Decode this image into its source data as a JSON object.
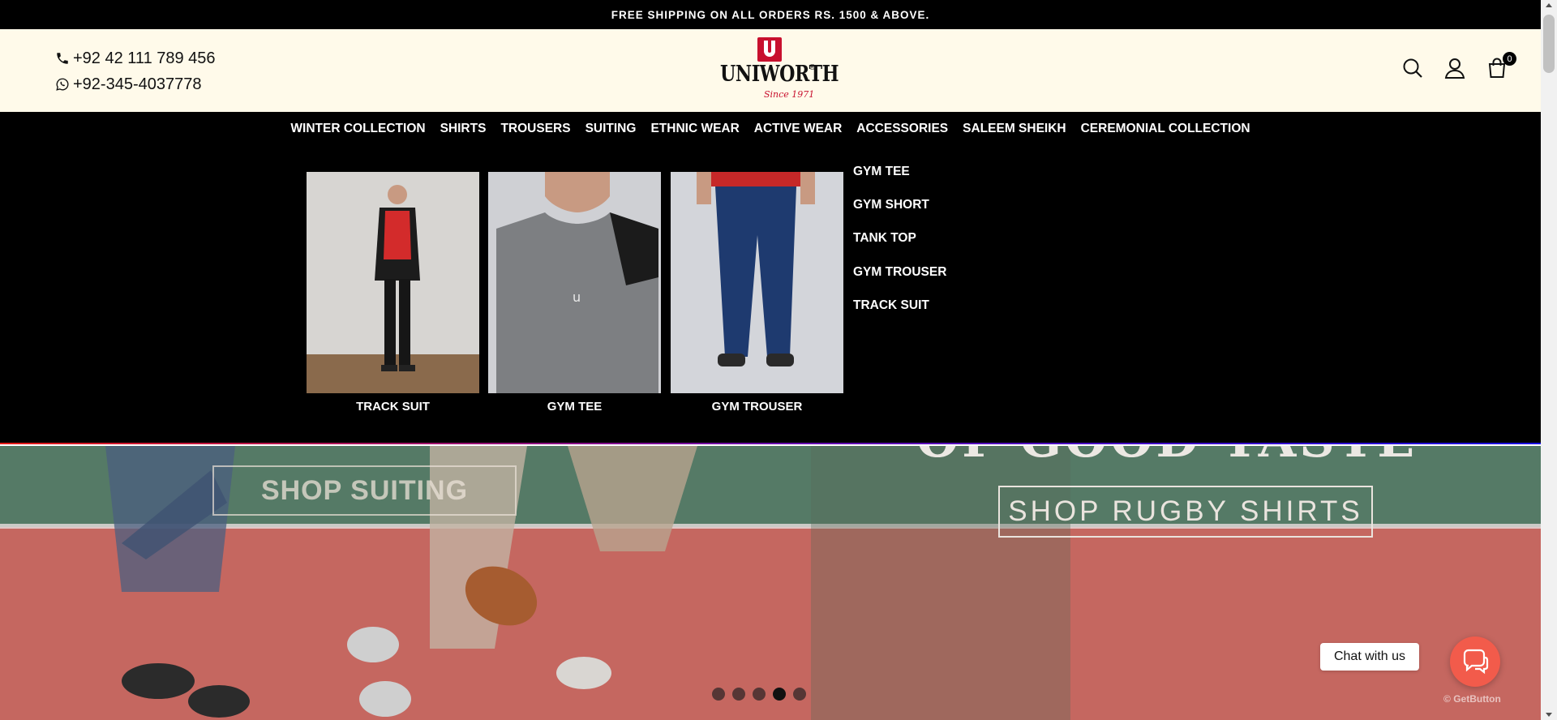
{
  "announcement": "FREE SHIPPING ON ALL ORDERS RS. 1500 & ABOVE.",
  "contact": {
    "phone": "+92 42 111 789 456",
    "whatsapp": "+92-345-4037778"
  },
  "logo": {
    "name": "UNIWORTH",
    "reg": "®",
    "tagline": "Since 1971"
  },
  "header_icons": [
    "search-icon",
    "user-icon",
    "cart-icon"
  ],
  "cart_count": "0",
  "nav": [
    "WINTER COLLECTION",
    "SHIRTS",
    "TROUSERS",
    "SUITING",
    "ETHNIC WEAR",
    "ACTIVE WEAR",
    "ACCESSORIES",
    "SALEEM SHEIKH",
    "CEREMONIAL COLLECTION"
  ],
  "mega_menu": {
    "cards": [
      {
        "caption": "TRACK SUIT"
      },
      {
        "caption": "GYM TEE"
      },
      {
        "caption": "GYM TROUSER"
      }
    ],
    "links": [
      "GYM TEE",
      "GYM SHORT",
      "TANK TOP",
      "GYM TROUSER",
      "TRACK SUIT"
    ]
  },
  "hero": {
    "title_fragment": "OF GOOD TASTE",
    "button_suiting": "SHOP SUITING",
    "button_rugby": "SHOP RUGBY SHIRTS",
    "slide_count": 5,
    "active_slide": 4
  },
  "chat": {
    "label": "Chat with us",
    "powered": "GetButton"
  },
  "colors": {
    "brand_red": "#c8102e",
    "header_bg": "#fffaea",
    "chat_button": "#f25b4b"
  }
}
